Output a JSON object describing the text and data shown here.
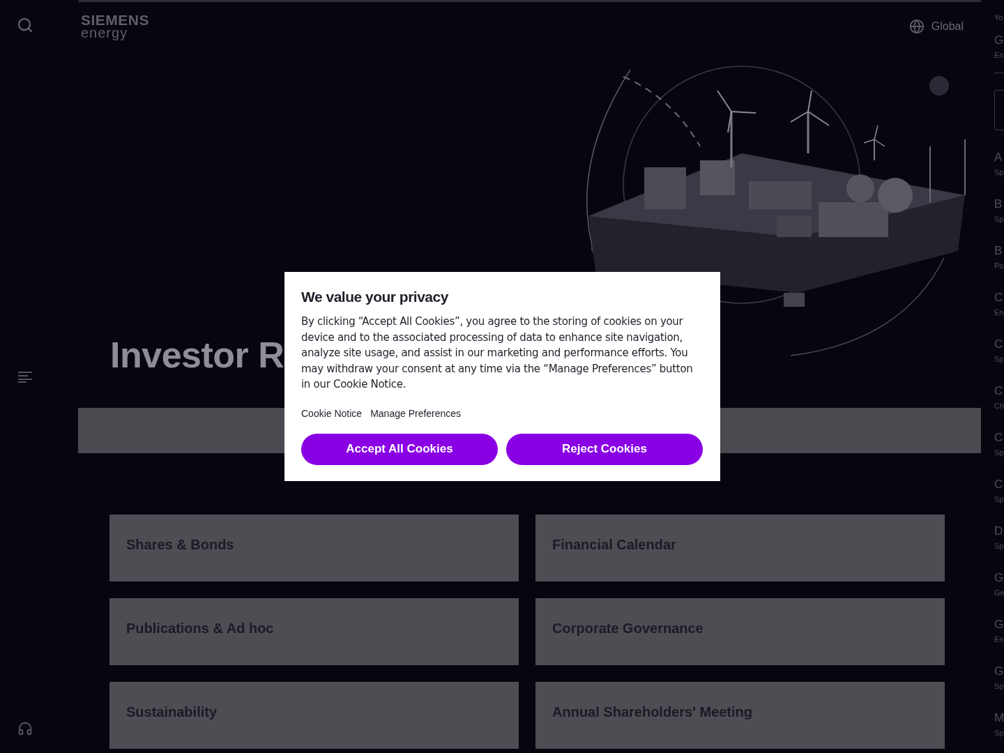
{
  "header": {
    "logo": {
      "line1": "SIEMENS",
      "line2": "energy"
    },
    "region": "Global"
  },
  "hero": {
    "title": "Investor R"
  },
  "tiles": [
    {
      "label": "Shares & Bonds"
    },
    {
      "label": "Financial Calendar"
    },
    {
      "label": "Publications & Ad hoc"
    },
    {
      "label": "Corporate Governance"
    },
    {
      "label": "Sustainability"
    },
    {
      "label": "Annual Shareholders' Meeting"
    }
  ],
  "side_panel": {
    "heading": "Yo",
    "current": {
      "title": "G",
      "subtitle": "En"
    },
    "items": [
      {
        "title": "A",
        "subtitle": "Sp"
      },
      {
        "title": "B",
        "subtitle": "Sp"
      },
      {
        "title": "B",
        "subtitle": "Po"
      },
      {
        "title": "C",
        "subtitle": "En"
      },
      {
        "title": "C",
        "subtitle": "Sp"
      },
      {
        "title": "C",
        "subtitle": "Ch"
      },
      {
        "title": "C",
        "subtitle": "Sp"
      },
      {
        "title": "C",
        "subtitle": "Sp"
      },
      {
        "title": "D",
        "subtitle": "Sp"
      },
      {
        "title": "G",
        "subtitle": "Ge"
      },
      {
        "title": "G",
        "subtitle": "En"
      },
      {
        "title": "G",
        "subtitle": "Sp"
      },
      {
        "title": "M",
        "subtitle": "Sp"
      }
    ]
  },
  "cookie_dialog": {
    "title": "We value your privacy",
    "body": "By clicking “Accept All Cookies”, you agree to the storing of cookies on your device and to the associated processing of data to enhance site navigation, analyze site usage, and assist in our marketing and performance efforts. You may withdraw your consent at any time via the “Manage Preferences” button in our Cookie Notice.",
    "links": [
      "Cookie Notice",
      "Manage Preferences"
    ],
    "buttons": [
      "Accept All Cookies",
      "Reject Cookies"
    ]
  }
}
